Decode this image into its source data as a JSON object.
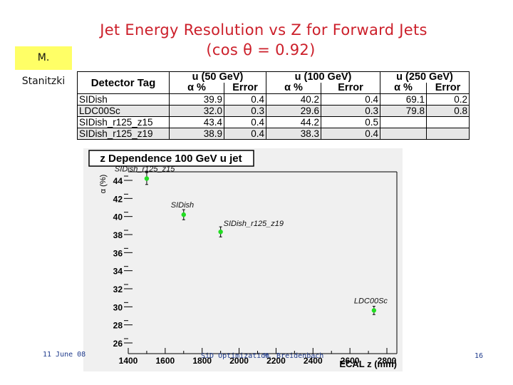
{
  "slide": {
    "title_line1": "Jet Energy Resolution vs Z for Forward Jets",
    "title_line2": "(cos θ = 0.92)",
    "author": "M. Stanitzki",
    "footer_date": "11 June 08",
    "footer_center": "SiD Optimization",
    "footer_author": "M. Breidenbach",
    "page_number": "16"
  },
  "table": {
    "tag_header": "Detector Tag",
    "groups": [
      "u (50 GeV)",
      "u (100 GeV)",
      "u (250 GeV)"
    ],
    "subheaders": [
      "α %",
      "Error",
      "α %",
      "Error",
      "α %",
      "Error"
    ],
    "rows": [
      {
        "tag": "SIDish",
        "values": [
          "39.9",
          "0.4",
          "40.2",
          "0.4",
          "69.1",
          "0.2"
        ]
      },
      {
        "tag": "LDC00Sc",
        "values": [
          "32.0",
          "0.3",
          "29.6",
          "0.3",
          "79.8",
          "0.8"
        ]
      },
      {
        "tag": "SIDish_r125_z15",
        "values": [
          "43.4",
          "0.4",
          "44.2",
          "0.5",
          "",
          ""
        ]
      },
      {
        "tag": "SIDish_r125_z19",
        "values": [
          "38.9",
          "0.4",
          "38.3",
          "0.4",
          "",
          ""
        ]
      }
    ]
  },
  "chart_data": {
    "type": "scatter",
    "title": "z Dependence 100 GeV u jet",
    "xlabel": "ECAL z (mm)",
    "ylabel": "α (%)",
    "xlim": [
      1400,
      2800
    ],
    "ylim": [
      25.8,
      45.2
    ],
    "xticks": [
      1400,
      1600,
      1800,
      2000,
      2200,
      2400,
      2600,
      2800
    ],
    "yticks": [
      26,
      28,
      30,
      32,
      34,
      36,
      38,
      40,
      42,
      44
    ],
    "marker_color": "#22dd22",
    "grid": false,
    "points": [
      {
        "label": "SIDish_r125_z15",
        "x": 1500,
        "y": 44.2,
        "err": 0.5
      },
      {
        "label": "SIDish",
        "x": 1700,
        "y": 40.2,
        "err": 0.4
      },
      {
        "label": "SIDish_r125_z19",
        "x": 1900,
        "y": 38.3,
        "err": 0.4
      },
      {
        "label": "LDC00Sc",
        "x": 2730,
        "y": 29.6,
        "err": 0.3
      }
    ]
  }
}
